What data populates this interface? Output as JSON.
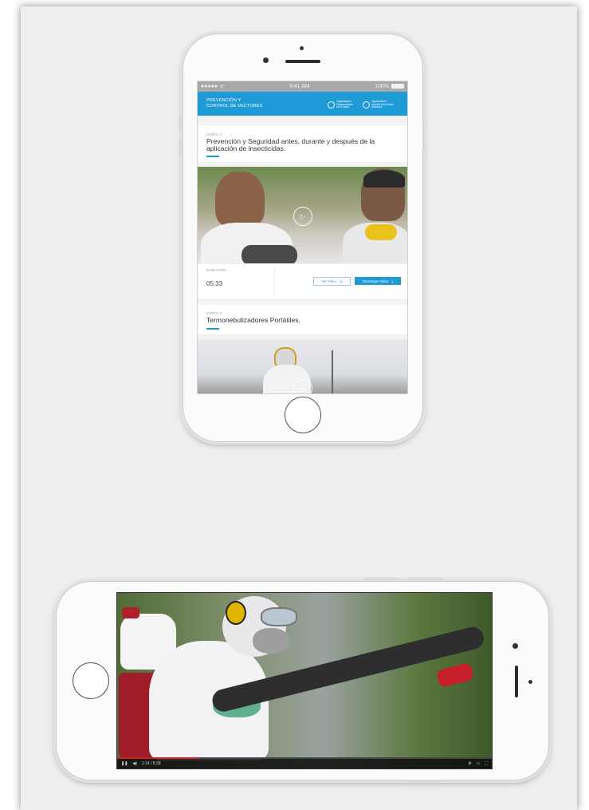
{
  "status_bar": {
    "signal": "●●●●● ᯤ",
    "time": "9:41 AM",
    "battery": "100%"
  },
  "app_bar": {
    "title_line1": "PREVENCIÓN Y",
    "title_line2": "CONTROL DE VECTORES",
    "logo_ops": [
      "Organización",
      "Panamericana",
      "de la Salud"
    ],
    "logo_oms": [
      "Organización",
      "Mundial de la Salud",
      "Américas"
    ]
  },
  "videos": [
    {
      "eyebrow": "VIDEO 1",
      "title": "Prevención y Seguridad antes, durante y después de la aplicación de insecticidas.",
      "duration_label": "DURACIÓN",
      "duration": "05:33",
      "view_label": "Ver Video",
      "download_label": "Descargar Video"
    },
    {
      "eyebrow": "VIDEO 2",
      "title": "Termonebulizadores Portátiles."
    }
  ],
  "landscape_player": {
    "time": "1:14 / 5:33",
    "progress": 0.22,
    "icons": [
      "pause-icon",
      "volume-icon",
      "settings-icon",
      "fullscreen-icon"
    ]
  },
  "colors": {
    "accent": "#1e9ad6",
    "board": "#eeeeef",
    "progress": "#cc1f1f"
  }
}
